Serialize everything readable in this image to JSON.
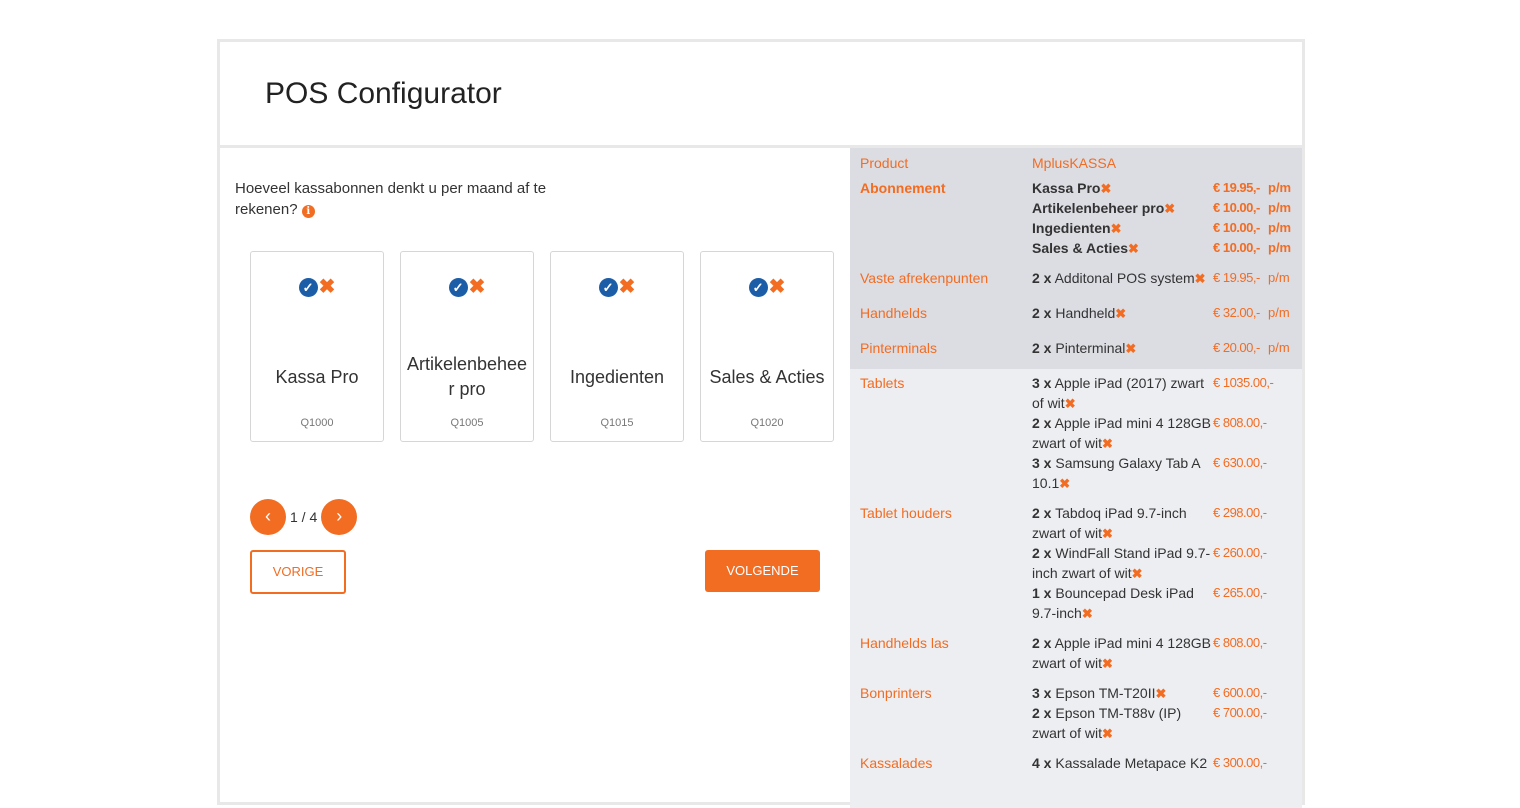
{
  "header": {
    "title": "POS Configurator"
  },
  "question": {
    "text": "Hoeveel kassabonnen denkt u per maand af te rekenen?",
    "info_icon": "info-circle-icon"
  },
  "options": [
    {
      "label": "Kassa Pro",
      "code": "Q1000"
    },
    {
      "label": "Artikelenbeheer pro",
      "code": "Q1005"
    },
    {
      "label": "Ingedienten",
      "code": "Q1015"
    },
    {
      "label": "Sales & Acties",
      "code": "Q1020"
    }
  ],
  "pager": {
    "text": "1 / 4",
    "prev_icon": "‹",
    "next_icon": "›"
  },
  "buttons": {
    "prev": "VORIGE",
    "next": "VOLGENDE"
  },
  "colors": {
    "accent": "#f26c22",
    "check": "#1c5da8",
    "summary_bg": "#edeef2",
    "summary_shade": "#dcdde3"
  },
  "summary": {
    "product_label": "Product",
    "product_value": "MplusKASSA",
    "abonnement": {
      "label": "Abonnement",
      "items": [
        {
          "name": "Kassa Pro",
          "price": "€ 19.95,-",
          "period": "p/m"
        },
        {
          "name": "Artikelenbeheer pro",
          "price": "€ 10.00,-",
          "period": "p/m"
        },
        {
          "name": "Ingedienten",
          "price": "€ 10.00,-",
          "period": "p/m"
        },
        {
          "name": "Sales & Acties",
          "price": "€ 10.00,-",
          "period": "p/m"
        }
      ]
    },
    "vaste": {
      "label": "Vaste afrekenpunten",
      "qty": "2 x",
      "name": "Additonal POS system",
      "price": "€ 19.95,-",
      "period": "p/m"
    },
    "handhelds": {
      "label": "Handhelds",
      "qty": "2 x",
      "name": "Handheld",
      "price": "€ 32.00,-",
      "period": "p/m"
    },
    "pinterminals": {
      "label": "Pinterminals",
      "qty": "2 x",
      "name": "Pinterminal",
      "price": "€ 20.00,-",
      "period": "p/m"
    },
    "tablets": {
      "label": "Tablets",
      "items": [
        {
          "qty": "3 x",
          "name": "Apple iPad (2017) zwart of wit",
          "price": "€ 1035.00,-"
        },
        {
          "qty": "2 x",
          "name": "Apple iPad mini 4 128GB zwart of wit",
          "price": "€ 808.00,-"
        },
        {
          "qty": "3 x",
          "name": "Samsung Galaxy Tab A 10.1",
          "price": "€ 630.00,-"
        }
      ]
    },
    "tablet_houders": {
      "label": "Tablet houders",
      "items": [
        {
          "qty": "2 x",
          "name": "Tabdoq iPad 9.7-inch zwart of wit",
          "price": "€ 298.00,-"
        },
        {
          "qty": "2 x",
          "name": "WindFall Stand iPad 9.7-inch zwart of wit",
          "price": "€ 260.00,-"
        },
        {
          "qty": "1 x",
          "name": "Bouncepad Desk iPad 9.7-inch",
          "price": "€ 265.00,-"
        }
      ]
    },
    "handhelds_las": {
      "label": "Handhelds las",
      "items": [
        {
          "qty": "2 x",
          "name": "Apple iPad mini 4 128GB zwart of wit",
          "price": "€ 808.00,-"
        }
      ]
    },
    "bonprinters": {
      "label": "Bonprinters",
      "items": [
        {
          "qty": "3 x",
          "name": "Epson TM-T20II",
          "price": "€ 600.00,-"
        },
        {
          "qty": "2 x",
          "name": "Epson TM-T88v (IP) zwart of wit",
          "price": "€ 700.00,-"
        }
      ]
    },
    "kassalades": {
      "label": "Kassalades",
      "items": [
        {
          "qty": "4 x",
          "name": "Kassalade Metapace K2",
          "price": "€ 300.00,-"
        }
      ]
    }
  }
}
